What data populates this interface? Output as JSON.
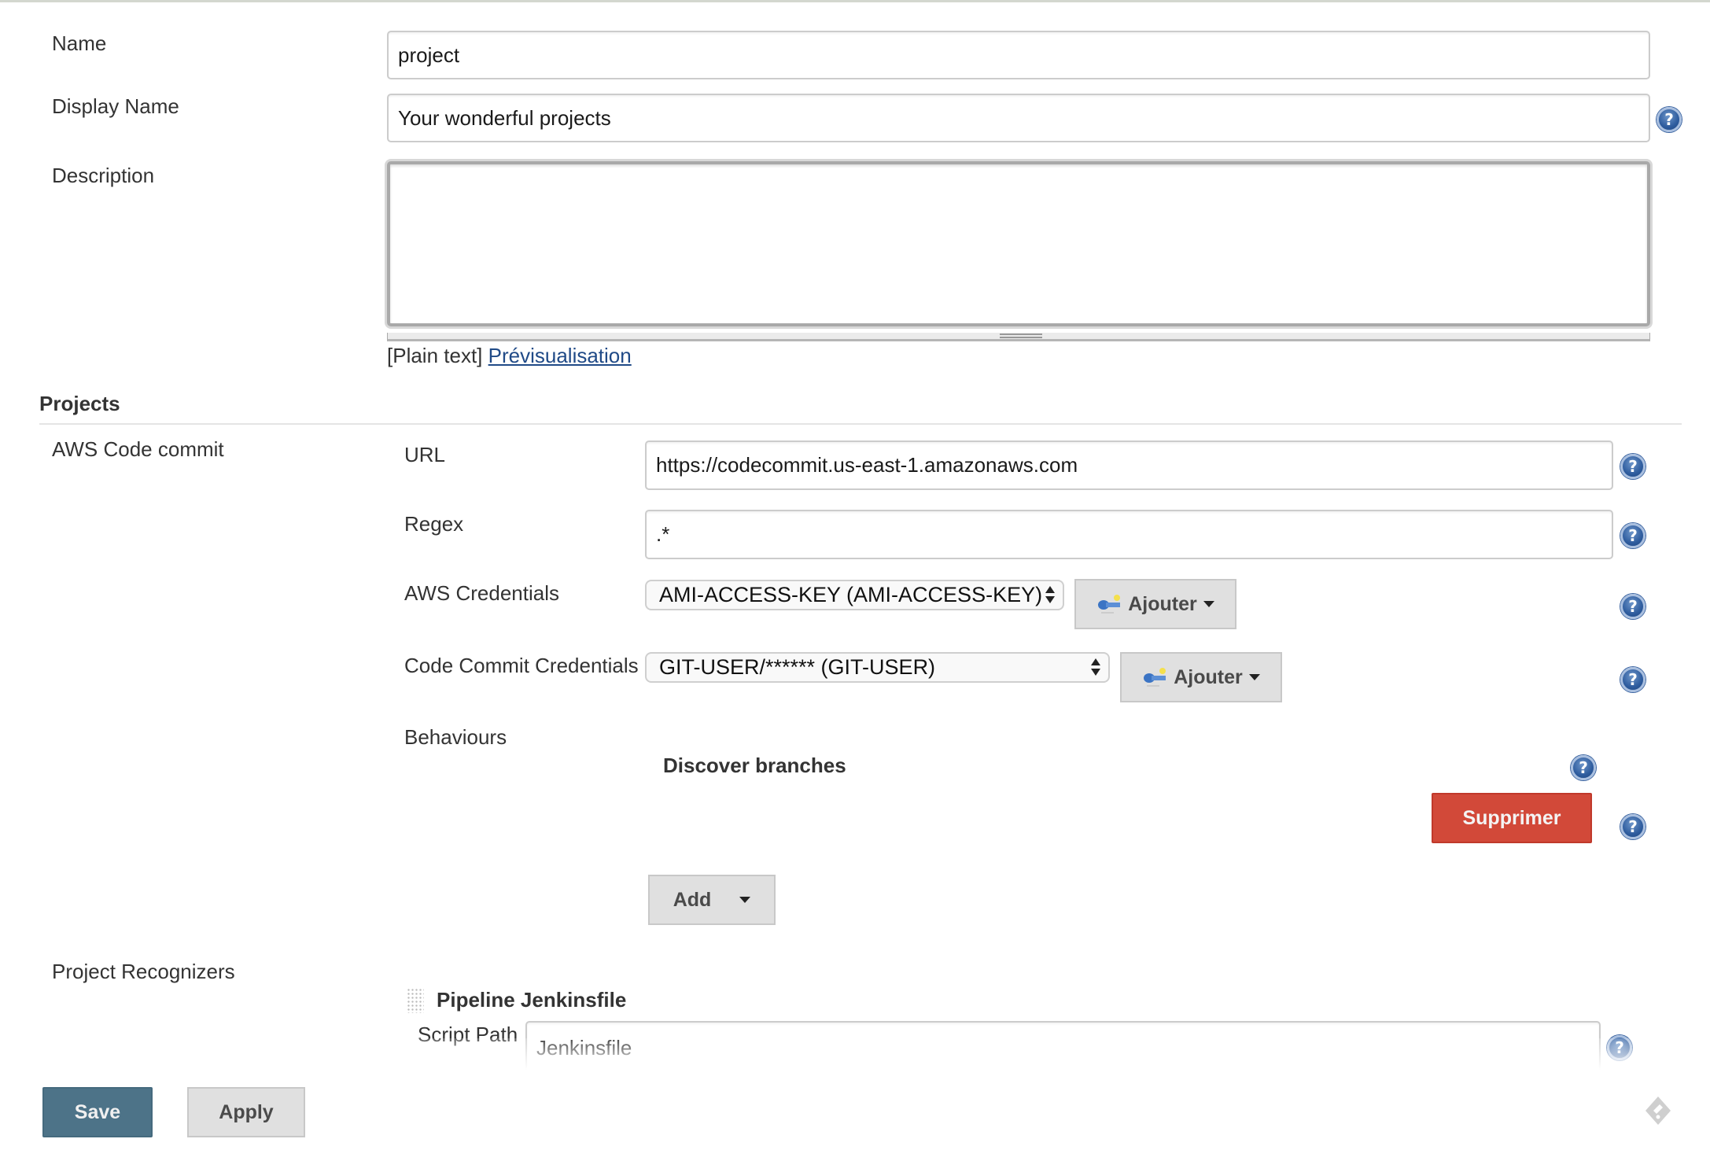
{
  "form": {
    "name": {
      "label": "Name",
      "value": "project"
    },
    "display_name": {
      "label": "Display Name",
      "value": "Your wonderful projects"
    },
    "description": {
      "label": "Description",
      "value": ""
    },
    "description_format": {
      "plain_text": "[Plain text]",
      "preview_link": "Prévisualisation"
    }
  },
  "projects_section": {
    "title": "Projects",
    "source": {
      "label": "AWS Code commit",
      "url": {
        "label": "URL",
        "value": "https://codecommit.us-east-1.amazonaws.com"
      },
      "regex": {
        "label": "Regex",
        "value": ".*"
      },
      "aws_credentials": {
        "label": "AWS Credentials",
        "selected": "AMI-ACCESS-KEY (AMI-ACCESS-KEY)",
        "add_button": "Ajouter"
      },
      "codecommit_credentials": {
        "label": "Code Commit Credentials",
        "selected": "GIT-USER/****** (GIT-USER)",
        "add_button": "Ajouter"
      },
      "behaviours": {
        "label": "Behaviours",
        "items": [
          {
            "title": "Discover branches",
            "delete_button": "Supprimer"
          }
        ],
        "add_button": "Add"
      }
    },
    "project_recognizers": {
      "label": "Project Recognizers",
      "items": [
        {
          "title": "Pipeline Jenkinsfile",
          "script_path_label": "Script Path",
          "script_path_value": "Jenkinsfile"
        }
      ]
    }
  },
  "footer": {
    "save": "Save",
    "apply": "Apply"
  },
  "icons": {
    "help": "help-question-icon",
    "key": "credentials-key-icon",
    "drag": "drag-handle-icon",
    "corner": "feedback-icon"
  },
  "colors": {
    "danger": "#d24939",
    "primary": "#4d7388",
    "link": "#204a87",
    "help": "#2e5c9e"
  }
}
